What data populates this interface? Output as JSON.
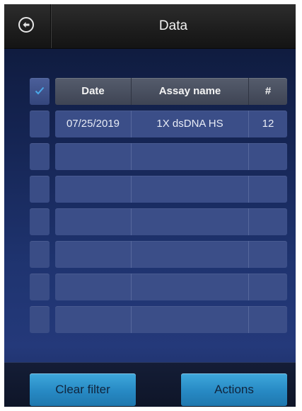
{
  "header": {
    "title": "Data"
  },
  "table": {
    "columns": {
      "date": "Date",
      "assay_name": "Assay name",
      "count": "#"
    },
    "rows": [
      {
        "date": "07/25/2019",
        "assay_name": "1X dsDNA HS",
        "count": "12"
      },
      {
        "date": "",
        "assay_name": "",
        "count": ""
      },
      {
        "date": "",
        "assay_name": "",
        "count": ""
      },
      {
        "date": "",
        "assay_name": "",
        "count": ""
      },
      {
        "date": "",
        "assay_name": "",
        "count": ""
      },
      {
        "date": "",
        "assay_name": "",
        "count": ""
      },
      {
        "date": "",
        "assay_name": "",
        "count": ""
      }
    ]
  },
  "footer": {
    "clear_filter_label": "Clear filter",
    "actions_label": "Actions"
  },
  "colors": {
    "accent": "#2b8fd0",
    "checkmark": "#4aa8e8",
    "header_bg": "#1e1e1e",
    "background": "#1a2b5e"
  },
  "icons": {
    "back": "back-arrow-circle-icon",
    "select_all": "checkmark-icon"
  }
}
